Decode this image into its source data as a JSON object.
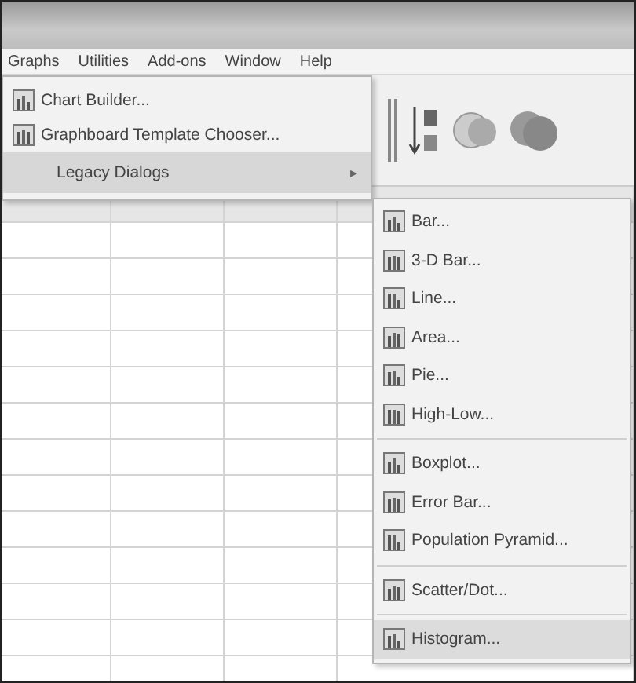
{
  "menu_bar": [
    "Graphs",
    "Utilities",
    "Add-ons",
    "Window",
    "Help"
  ],
  "graphs_menu": [
    {
      "label": "Chart Builder...",
      "kind": "item",
      "selected": false
    },
    {
      "label": "Graphboard Template Chooser...",
      "kind": "item",
      "selected": false
    },
    {
      "label": "Legacy Dialogs",
      "kind": "submenu",
      "arrow": "▸",
      "selected": true
    }
  ],
  "legacy_dialogs_menu": [
    [
      {
        "label": "Bar...",
        "selected": false
      },
      {
        "label": "3-D Bar...",
        "selected": false
      },
      {
        "label": "Line...",
        "selected": false
      },
      {
        "label": "Area...",
        "selected": false
      },
      {
        "label": "Pie...",
        "selected": false
      },
      {
        "label": "High-Low...",
        "selected": false
      }
    ],
    [
      {
        "label": "Boxplot...",
        "selected": false
      },
      {
        "label": "Error Bar...",
        "selected": false
      },
      {
        "label": "Population Pyramid...",
        "selected": false
      }
    ],
    [
      {
        "label": "Scatter/Dot...",
        "selected": false
      }
    ],
    [
      {
        "label": "Histogram...",
        "selected": true
      }
    ]
  ]
}
